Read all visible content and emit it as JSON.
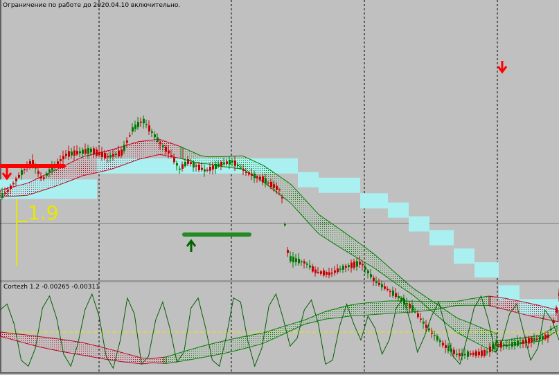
{
  "notice": "Ограничение по работе до 2020.04.10 включительно.",
  "indicator_panel": {
    "name": "Cortezh 1.2",
    "value_1": "-0.00265",
    "value_2": "-0.00311"
  },
  "colors": {
    "background": "#c0c0c0",
    "candle": "#007800",
    "candle_bear": "#c80000",
    "band_up": "#008000",
    "band_down": "#c00020",
    "cloud": "#aaf0f0",
    "signal_line": "#e8e800",
    "level_line_down": "#ff0000",
    "level_line_up": "#228b22",
    "arrow_down": "#ff0000",
    "arrow_up": "#006400"
  },
  "chart_data": [
    {
      "type": "candlestick",
      "panel": "main",
      "marker_label": "1.9",
      "price_trend": [
        [
          0,
          0.12
        ],
        [
          10,
          0.18
        ],
        [
          30,
          0.38
        ],
        [
          45,
          0.5
        ],
        [
          60,
          0.3
        ],
        [
          70,
          0.4
        ],
        [
          95,
          0.58
        ],
        [
          130,
          0.62
        ],
        [
          155,
          0.55
        ],
        [
          175,
          0.6
        ],
        [
          190,
          0.85
        ],
        [
          205,
          0.95
        ],
        [
          230,
          0.7
        ],
        [
          245,
          0.58
        ],
        [
          258,
          0.42
        ],
        [
          270,
          0.5
        ],
        [
          295,
          0.4
        ],
        [
          320,
          0.48
        ],
        [
          335,
          0.5
        ],
        [
          355,
          0.38
        ],
        [
          380,
          0.3
        ],
        [
          405,
          0.18
        ],
        [
          415,
          -0.55
        ],
        [
          440,
          -0.6
        ],
        [
          455,
          -0.7
        ],
        [
          475,
          -0.72
        ],
        [
          495,
          -0.65
        ],
        [
          520,
          -0.6
        ],
        [
          540,
          -0.8
        ],
        [
          570,
          -0.95
        ],
        [
          595,
          -1.1
        ],
        [
          615,
          -1.3
        ],
        [
          640,
          -1.5
        ],
        [
          660,
          -1.6
        ],
        [
          700,
          -1.58
        ],
        [
          715,
          -1.48
        ],
        [
          730,
          -1.5
        ],
        [
          760,
          -1.45
        ],
        [
          790,
          -1.4
        ],
        [
          800,
          -1.2
        ],
        [
          807,
          -0.9
        ]
      ],
      "band": [
        [
          0,
          0.15
        ],
        [
          40,
          0.2
        ],
        [
          80,
          0.32
        ],
        [
          120,
          0.45
        ],
        [
          160,
          0.52
        ],
        [
          200,
          0.62
        ],
        [
          230,
          0.66
        ],
        [
          260,
          0.6
        ],
        [
          290,
          0.52
        ],
        [
          320,
          0.5
        ],
        [
          350,
          0.49
        ],
        [
          380,
          0.37
        ],
        [
          420,
          0.15
        ],
        [
          460,
          -0.18
        ],
        [
          500,
          -0.38
        ],
        [
          540,
          -0.58
        ],
        [
          580,
          -0.82
        ],
        [
          620,
          -1.05
        ],
        [
          660,
          -1.28
        ],
        [
          700,
          -1.42
        ],
        [
          720,
          -1.48
        ],
        [
          750,
          -1.45
        ],
        [
          780,
          -1.42
        ],
        [
          807,
          -1.3
        ]
      ],
      "cloud_steps": [
        [
          0,
          0.2
        ],
        [
          140,
          0.43
        ],
        [
          430,
          0.28
        ],
        [
          460,
          0.22
        ],
        [
          520,
          0.05
        ],
        [
          560,
          -0.05
        ],
        [
          590,
          -0.2
        ],
        [
          620,
          -0.35
        ],
        [
          655,
          -0.55
        ],
        [
          685,
          -0.7
        ],
        [
          720,
          -0.95
        ],
        [
          750,
          -1.1
        ],
        [
          780,
          -1.1
        ],
        [
          807,
          -1.1
        ]
      ],
      "band_switch_x": 265,
      "level_down": [
        0,
        92
      ],
      "level_up": [
        266,
        360
      ],
      "arrows": [
        {
          "x": 10,
          "dir": "down"
        },
        {
          "x": 276,
          "dir": "up"
        },
        {
          "x": 725,
          "dir": "down"
        }
      ]
    },
    {
      "type": "line",
      "panel": "indicator",
      "series": [
        {
          "values": [
            0.55,
            0.7,
            0.2,
            -0.7,
            -0.85,
            -0.4,
            0.6,
            0.9,
            0.35,
            -0.55,
            -0.85,
            -0.3,
            0.55,
            0.95,
            0.4,
            -0.6,
            -0.9,
            -0.2,
            0.85,
            0.45,
            -0.8,
            -0.6,
            0.3,
            0.75,
            0.1,
            -0.75,
            -0.5,
            0.6,
            0.85,
            0.15,
            -0.7,
            -0.85,
            -0.1,
            0.85,
            0.75,
            -0.2,
            -0.85,
            -0.4,
            0.65,
            0.95,
            0.35,
            -0.35,
            -0.15,
            0.55,
            0.8,
            0.2,
            -0.8,
            -0.7,
            0.15,
            0.7,
            0.2,
            -0.2,
            0.4,
            0.1,
            -0.55,
            -0.2,
            0.6,
            0.85,
            0.25,
            -0.5,
            -0.1,
            0.4,
            0.75,
            0.1,
            -0.6,
            -0.8,
            -0.15,
            0.6,
            0.9,
            0.3,
            -0.5,
            -0.2,
            0.45,
            0.7,
            0.0,
            -0.7,
            -0.4,
            0.55,
            0.3,
            -0.2
          ]
        },
        {
          "points": [
            [
              0,
              -0.05
            ],
            [
              60,
              -0.25
            ],
            [
              120,
              -0.42
            ],
            [
              175,
              -0.62
            ],
            [
              205,
              -0.72
            ],
            [
              240,
              -0.7
            ],
            [
              290,
              -0.5
            ],
            [
              330,
              -0.35
            ],
            [
              380,
              -0.15
            ],
            [
              410,
              0.05
            ],
            [
              440,
              0.25
            ],
            [
              470,
              0.42
            ],
            [
              510,
              0.55
            ],
            [
              560,
              0.62
            ],
            [
              620,
              0.65
            ],
            [
              680,
              0.75
            ],
            [
              706,
              0.78
            ],
            [
              730,
              0.7
            ],
            [
              760,
              0.58
            ],
            [
              807,
              0.4
            ]
          ]
        }
      ],
      "reference_level": 0
    }
  ]
}
